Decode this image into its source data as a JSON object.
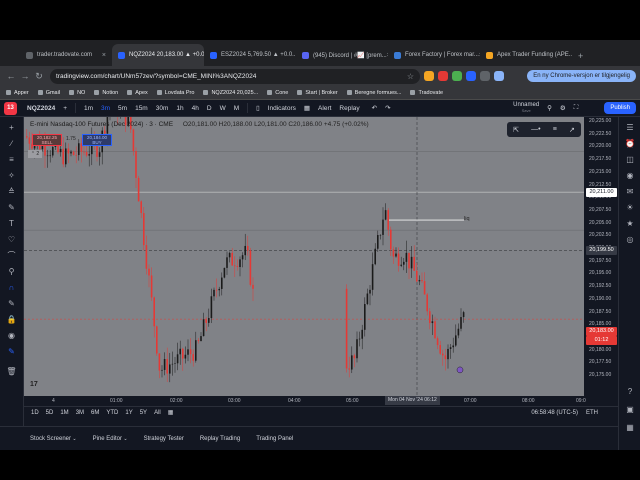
{
  "browser": {
    "tabs": [
      {
        "label": "trader.tradovate.com",
        "color": "#5f6368",
        "active": false
      },
      {
        "label": "NQZ2024 20,183.00 ▲ +0.0...",
        "color": "#2962ff",
        "active": true
      },
      {
        "label": "ESZ2024 5,769.50 ▲ +0.0...",
        "color": "#2962ff",
        "active": false
      },
      {
        "label": "(945) Discord | #📈 [prem...",
        "color": "#5865f2",
        "active": false
      },
      {
        "label": "Forex Factory | Forex mar...",
        "color": "#3a7bd5",
        "active": false
      },
      {
        "label": "Apex Trader Funding (APE...",
        "color": "#f5a623",
        "active": false
      }
    ],
    "url": "tradingview.com/chart/UNm57zev/?symbol=CME_MINI%3ANQZ2024",
    "update_label": "En ny Chrome-versjon er tilgjengelig",
    "bookmarks": [
      "Apper",
      "Gmail",
      "NO",
      "Notion",
      "Apex",
      "Lovdata Pro",
      "NQZ2024 20,025...",
      "Cone",
      "Start | Broker",
      "Beregne formues...",
      "Tradovate"
    ]
  },
  "tv": {
    "symbol": "NQZ2024",
    "intervals": [
      "1m",
      "3m",
      "5m",
      "15m",
      "30m",
      "1h",
      "4h",
      "D",
      "W",
      "M"
    ],
    "indicators_label": "Indicators",
    "alert_label": "Alert",
    "replay_label": "Replay",
    "layout_name": "Unnamed",
    "layout_sub": "Save",
    "publish_label": "Publish",
    "notification_count": "13",
    "legend": {
      "name": "E-mini Nasdaq-100 Futures (Dec 2024) · 3 · CME",
      "ohlc": "O20,181.00 H20,188.00 L20,181.00 C20,186.00 +4.75 (+0.02%)"
    },
    "sell": {
      "price": "20,182.25",
      "label": "SELL"
    },
    "buy": {
      "price": "20,184.00",
      "label": "BUY"
    },
    "spread": "1.75",
    "collapse_count": "2",
    "liq_label": "liq",
    "price_ticks": [
      "20,225.00",
      "20,222.50",
      "20,220.00",
      "20,217.50",
      "20,215.00",
      "20,212.50",
      "20,210.00",
      "20,207.50",
      "20,205.00",
      "20,202.50",
      "20,200.00",
      "20,197.50",
      "20,195.00",
      "20,192.50",
      "20,190.00",
      "20,187.50",
      "20,185.00",
      "20,182.50",
      "20,180.00",
      "20,177.50",
      "20,175.00"
    ],
    "hline_label": "20,211.00",
    "cross_price": "20,199.50",
    "last_price": "20,183.00",
    "last_countdown": "01:12",
    "time_ticks": [
      "4",
      "01:00",
      "02:00",
      "03:00",
      "04:00",
      "05:00",
      "06:00",
      "07:00",
      "08:00",
      "09:0"
    ],
    "cross_time": "Mon 04 Nov '24",
    "cross_time2": "06:12",
    "ranges": [
      "1D",
      "5D",
      "1M",
      "3M",
      "6M",
      "YTD",
      "1Y",
      "5Y",
      "All"
    ],
    "clock": "06:58:48 (UTC-5)",
    "session": "ETH",
    "bottom_tabs": [
      "Stock Screener",
      "Pine Editor",
      "Strategy Tester",
      "Replay Trading",
      "Trading Panel"
    ],
    "colors": {
      "bull": "#1a1a1a",
      "bear": "#e53935",
      "background": "#808287",
      "accent": "#2962ff"
    }
  }
}
